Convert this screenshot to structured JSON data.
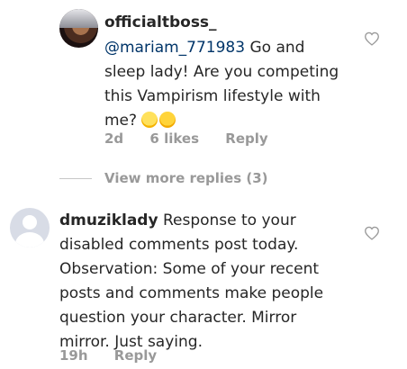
{
  "comment1": {
    "username": "officialtboss_",
    "mention": "@mariam_771983",
    "text_line1_rest": "Go and",
    "text_lines": [
      "sleep lady! Are you competing",
      "this Vampirism lifestyle with",
      "me?"
    ],
    "meta": {
      "time": "2d",
      "likes": "6 likes",
      "reply": "Reply"
    }
  },
  "view_more": "View more replies (3)",
  "comment2": {
    "username": "dmuziklady",
    "line1_rest": "Response to your",
    "text_lines": [
      "disabled comments post today.",
      "Observation: Some of your recent",
      "posts and comments make people",
      "question your character. Mirror",
      "mirror. Just saying."
    ],
    "meta": {
      "time": "19h",
      "reply": "Reply"
    }
  },
  "icons": {
    "like": "heart-outline-icon",
    "emoji_a": "sleeping-face-emoji",
    "emoji_b": "sleepy-face-emoji"
  }
}
